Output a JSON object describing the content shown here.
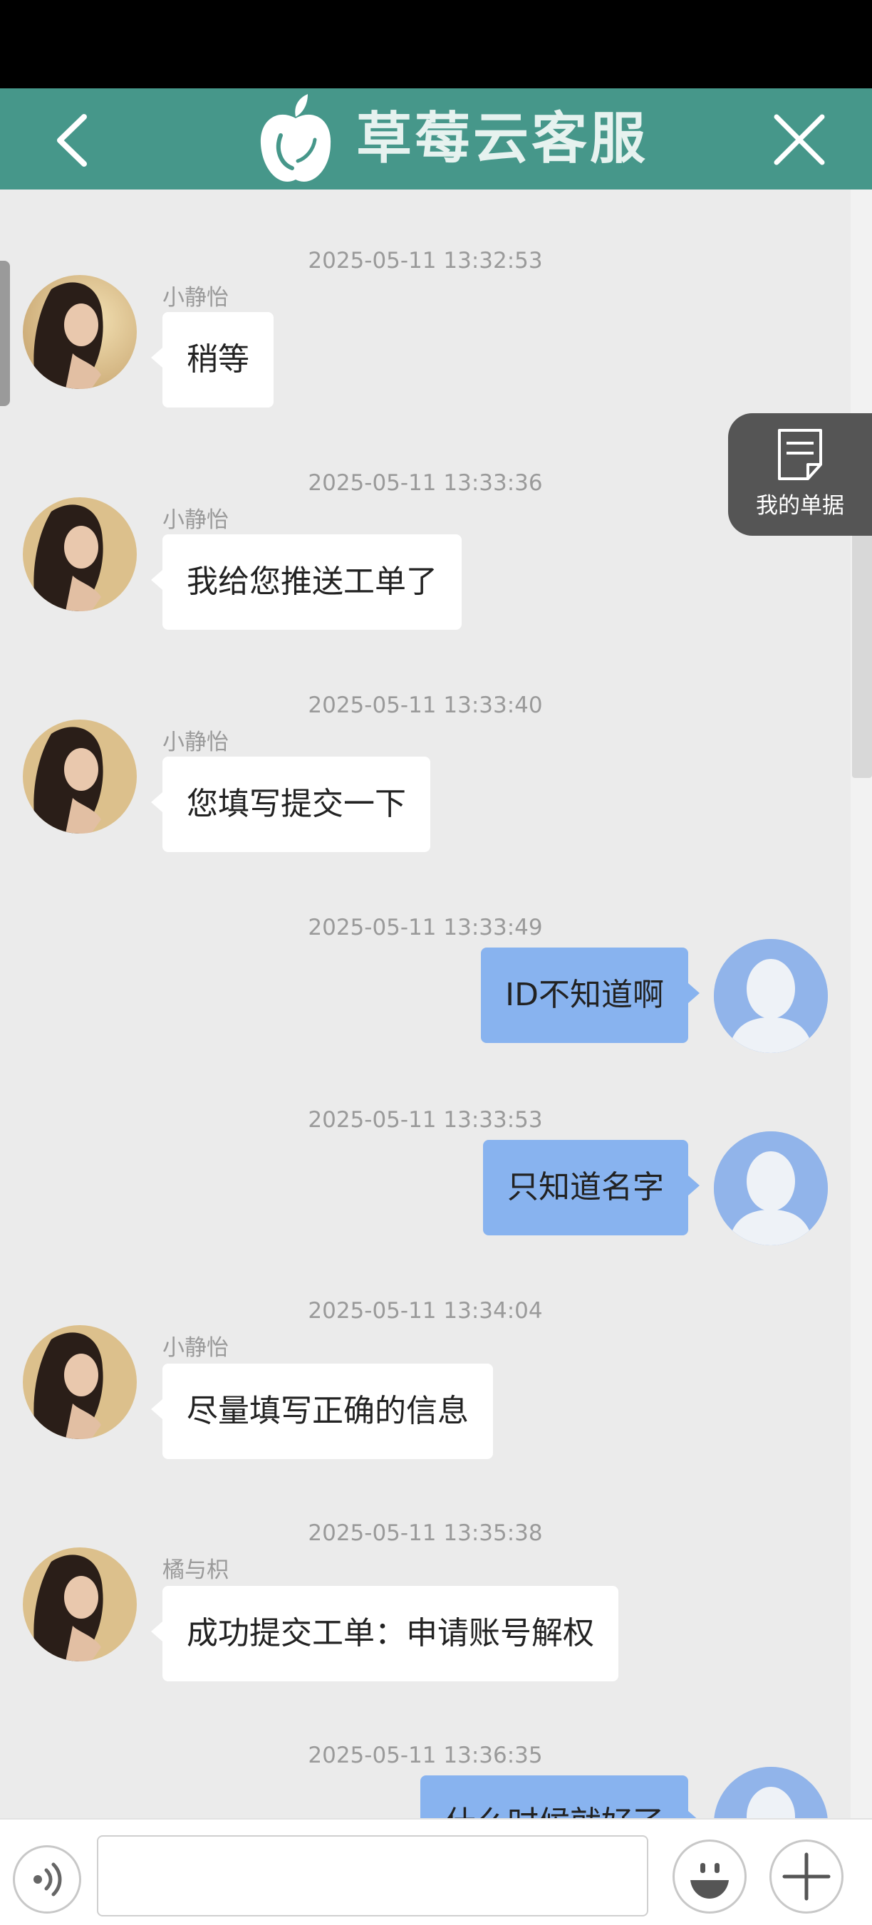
{
  "header": {
    "title": "草莓云客服",
    "back_icon": "chevron-left-icon",
    "close_icon": "close-icon",
    "logo_icon": "apple-logo-icon"
  },
  "floating": {
    "my_documents_label": "我的单据",
    "icon": "document-icon"
  },
  "messages": [
    {
      "time": "2025-05-11 13:32:53",
      "side": "left",
      "sender": "小静怡",
      "text": "稍等"
    },
    {
      "time": "2025-05-11 13:33:36",
      "side": "left",
      "sender": "小静怡",
      "text": "我给您推送工单了"
    },
    {
      "time": "2025-05-11 13:33:40",
      "side": "left",
      "sender": "小静怡",
      "text": "您填写提交一下"
    },
    {
      "time": "2025-05-11 13:33:49",
      "side": "right",
      "text": "ID不知道啊"
    },
    {
      "time": "2025-05-11 13:33:53",
      "side": "right",
      "text": "只知道名字"
    },
    {
      "time": "2025-05-11 13:34:04",
      "side": "left",
      "sender": "小静怡",
      "text": "尽量填写正确的信息"
    },
    {
      "time": "2025-05-11 13:35:38",
      "side": "left",
      "sender": "橘与枳",
      "text": "成功提交工单：申请账号解权"
    },
    {
      "time": "2025-05-11 13:36:35",
      "side": "right",
      "text": "什么时候就好了"
    }
  ],
  "input": {
    "placeholder": "",
    "voice_icon": "voice-icon",
    "emoji_icon": "emoji-icon",
    "plus_icon": "plus-icon"
  },
  "colors": {
    "header": "#46978a",
    "bubble_user": "#88b3ef",
    "bubble_agent": "#ffffff",
    "background": "#ebebeb"
  }
}
